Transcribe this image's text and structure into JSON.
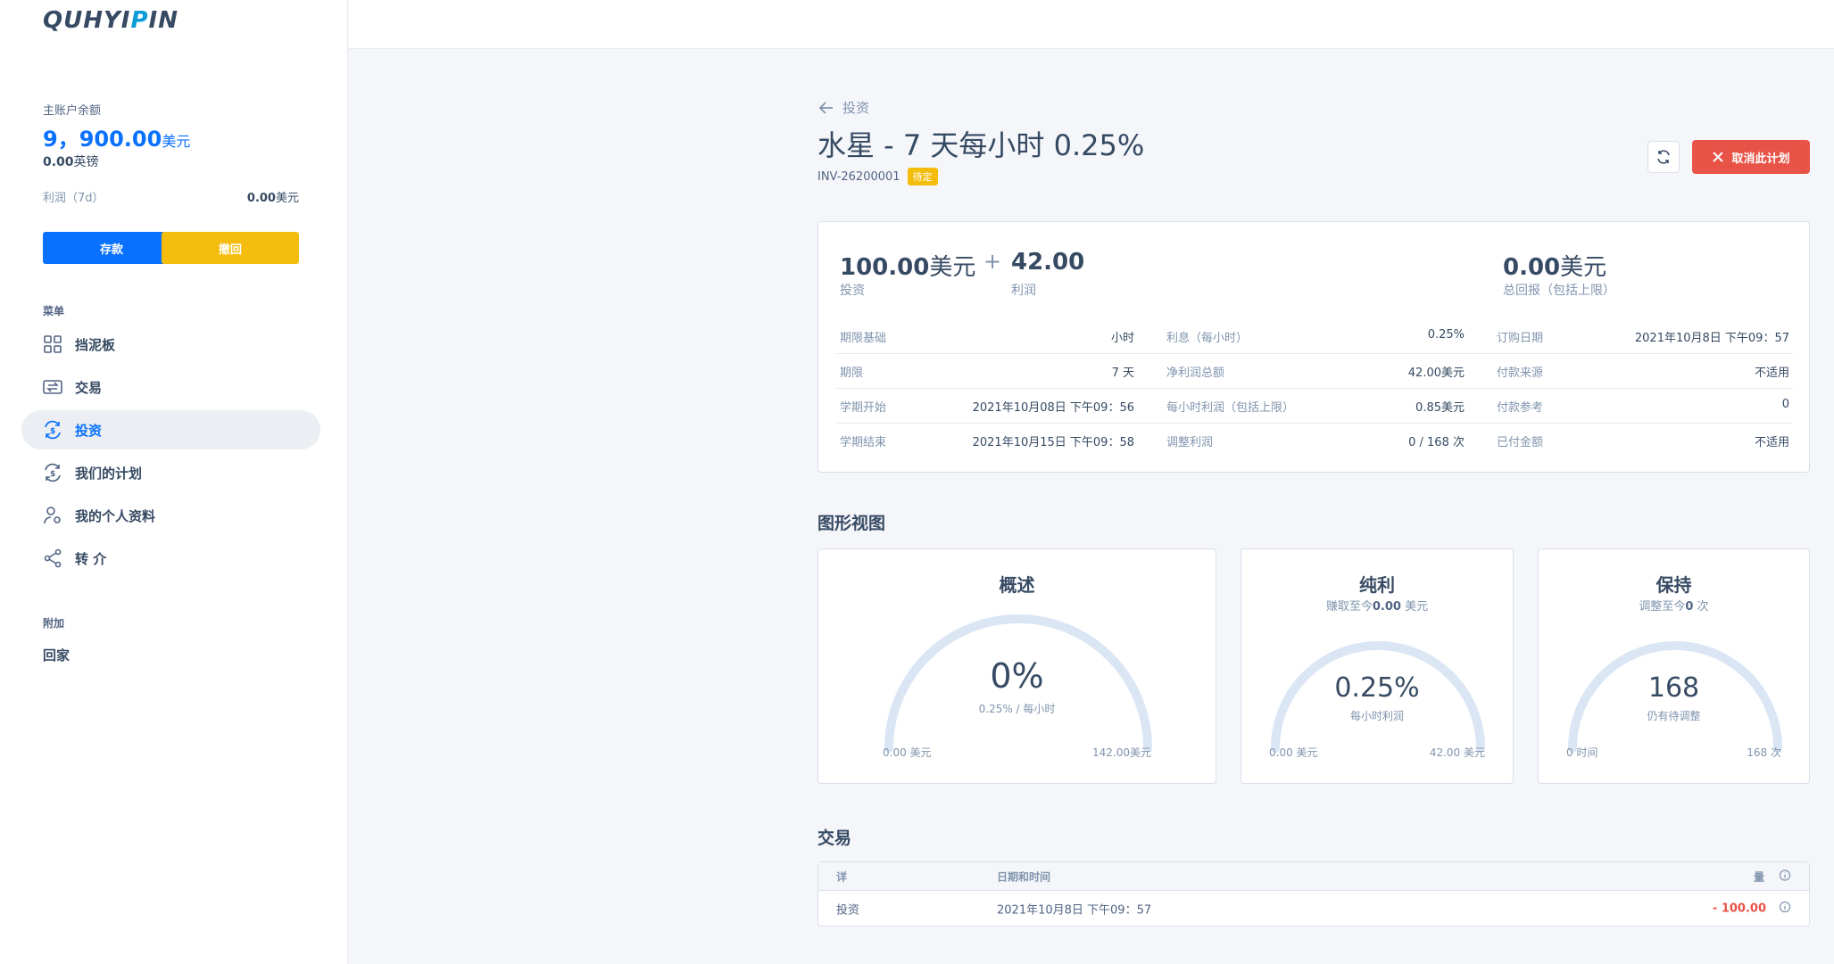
{
  "sidebar": {
    "logo_main": "QUHYI",
    "logo_accent": "P",
    "logo_end": "IN",
    "balance_label": "主账户余额",
    "balance_value": "9，900.00",
    "balance_unit": "美元",
    "balance_secondary_value": "0.00",
    "balance_secondary_unit": "英镑",
    "profit_label": "利润（7d）",
    "profit_value": "0.00",
    "profit_unit": "美元",
    "deposit_label": "存款",
    "withdraw_label": "撤回",
    "menu_label": "菜单",
    "nav": [
      {
        "label": "挡泥板"
      },
      {
        "label": "交易"
      },
      {
        "label": "投资"
      },
      {
        "label": "我们的计划"
      },
      {
        "label": "我的个人资料"
      },
      {
        "label": "转 介"
      }
    ],
    "extra_label": "附加",
    "extra_item": "回家"
  },
  "header": {
    "back_label": "投资",
    "title": "水星 - 7 天每小时 0.25%",
    "invoice_id": "INV-26200001",
    "status_badge": "待定",
    "cancel_label": "取消此计划"
  },
  "summary": {
    "invested_value": "100.00",
    "invested_unit": "美元",
    "invested_label": "投资",
    "profit_value": "42.00",
    "profit_label": "利润",
    "return_value": "0.00",
    "return_unit": "美元",
    "return_label": "总回报（包括上限）"
  },
  "details": [
    [
      {
        "k": "期限基础",
        "v": "小时"
      },
      {
        "k": "利息（每小时）",
        "v": "0.25%"
      },
      {
        "k": "订购日期",
        "v": "2021年10月8日 下午09：57"
      }
    ],
    [
      {
        "k": "期限",
        "v": "7 天"
      },
      {
        "k": "净利润总额",
        "v": "42.00美元"
      },
      {
        "k": "付款来源",
        "v": "不适用"
      }
    ],
    [
      {
        "k": "学期开始",
        "v": "2021年10月08日 下午09：56"
      },
      {
        "k": "每小时利润（包括上限）",
        "v": "0.85美元"
      },
      {
        "k": "付款参考",
        "v": "0"
      }
    ],
    [
      {
        "k": "学期结束",
        "v": "2021年10月15日 下午09：58"
      },
      {
        "k": "调整利润",
        "v": "0 / 168 次"
      },
      {
        "k": "已付金额",
        "v": "不适用"
      }
    ]
  ],
  "graph_section_title": "图形视图",
  "gauges": [
    {
      "title": "概述",
      "subtitle": "",
      "big": "0%",
      "small": "0.25% / 每小时",
      "left": "0.00 美元",
      "right": "142.00美元",
      "fraction": 0
    },
    {
      "title": "纯利",
      "subtitle_pre": "赚取至今",
      "subtitle_val": "0.00",
      "subtitle_post": " 美元",
      "big": "0.25%",
      "small": "每小时利润",
      "left": "0.00 美元",
      "right": "42.00 美元",
      "fraction": 0
    },
    {
      "title": "保持",
      "subtitle_pre": "调整至今",
      "subtitle_val": "0",
      "subtitle_post": " 次",
      "big": "168",
      "small": "仍有待调整",
      "left": "0 时间",
      "right": "168 次",
      "fraction": 0
    }
  ],
  "transactions": {
    "title": "交易",
    "col_detail": "详",
    "col_datetime": "日期和时间",
    "col_amount": "量",
    "rows": [
      {
        "detail": "投资",
        "datetime": "2021年10月8日 下午09：57",
        "amount": "- 100.00"
      }
    ]
  },
  "colors": {
    "primary": "#0971fe",
    "warning": "#f4bd0e",
    "danger": "#e85347",
    "gauge_track": "#dbe6f5"
  }
}
